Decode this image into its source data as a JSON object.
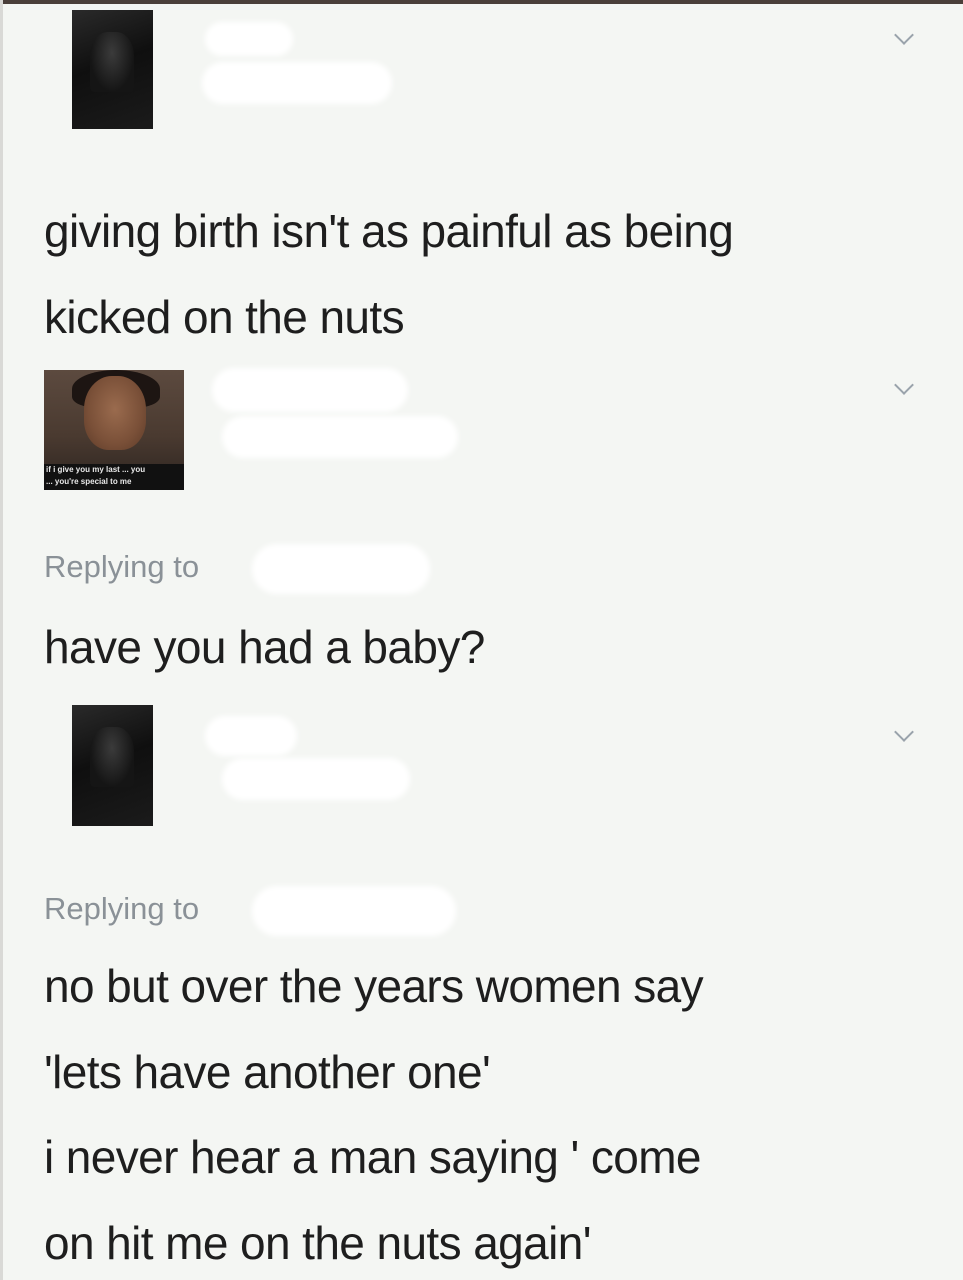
{
  "tweets": [
    {
      "text_lines": [
        "giving birth isn't as painful as being",
        "kicked on the nuts"
      ],
      "avatar": "dark-figure-avatar",
      "menu_icon": "chevron-down-icon"
    },
    {
      "replying_label": "Replying to",
      "text_lines": [
        "have you had a baby?"
      ],
      "avatar": "child-meme-avatar",
      "avatar_caption_lines": [
        "if i give you my last ... you",
        "... you're special to me"
      ],
      "menu_icon": "chevron-down-icon"
    },
    {
      "replying_label": "Replying to",
      "text_lines": [
        "no but over the years women say",
        "'lets have another one'",
        "i never hear a man saying ' come",
        "on hit me on the nuts again'"
      ],
      "avatar": "dark-figure-avatar",
      "menu_icon": "chevron-down-icon"
    }
  ],
  "colors": {
    "background": "#f4f6f3",
    "text": "#1e1e1e",
    "muted": "#8a9197",
    "chevron": "#9aa3ab"
  }
}
